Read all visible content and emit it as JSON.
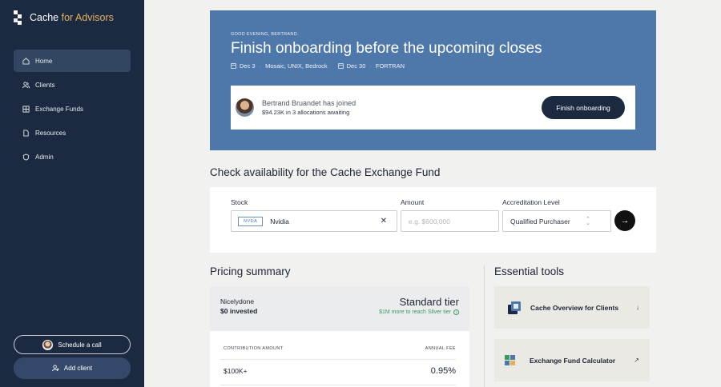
{
  "brand": {
    "name": "Cache",
    "suffix": " for Advisors"
  },
  "sidebar": {
    "items": [
      {
        "label": "Home",
        "icon": "home-icon",
        "active": true
      },
      {
        "label": "Clients",
        "icon": "users-icon"
      },
      {
        "label": "Exchange Funds",
        "icon": "grid-icon"
      },
      {
        "label": "Resources",
        "icon": "document-icon"
      },
      {
        "label": "Admin",
        "icon": "shield-icon"
      }
    ],
    "schedule_label": "Schedule a call",
    "add_client_label": "Add client"
  },
  "hero": {
    "greeting": "GOOD EVENING, BERTRAND.",
    "title": "Finish onboarding before the upcoming closes",
    "dates": [
      {
        "date": "Dec 3",
        "sep": "·",
        "detail": "Mosaic, UNIX, Bedrock"
      },
      {
        "date": "Dec 30",
        "sep": "·",
        "detail": "FORTRAN"
      }
    ],
    "card": {
      "name": "Bertrand Bruandet has joined",
      "sub": "$94.23K in 3 allocations awaiting",
      "button": "Finish onboarding"
    }
  },
  "availability": {
    "title": "Check availability for the Cache Exchange Fund",
    "stock_label": "Stock",
    "stock_ticker": "NVDA",
    "stock_value": "Nvidia",
    "clear_symbol": "✕",
    "amount_label": "Amount",
    "amount_placeholder": "e.g. $600,000",
    "accreditation_label": "Accreditation Level",
    "accreditation_value": "Qualified Purchaser",
    "go_symbol": "→"
  },
  "pricing": {
    "title": "Pricing summary",
    "client": "Nicelydone",
    "invested": "$0 invested",
    "tier": "Standard tier",
    "upgrade_note": "$1M more to reach Silver tier",
    "info_symbol": "i",
    "col_amount": "CONTRIBUTION AMOUNT",
    "col_fee": "ANNUAL FEE",
    "rows": [
      {
        "amount": "$100K+",
        "fee": "0.95%"
      }
    ]
  },
  "tools": {
    "title": "Essential tools",
    "items": [
      {
        "label": "Cache Overview for Clients",
        "action": "↓"
      },
      {
        "label": "Exchange Fund Calculator",
        "action": "↗"
      }
    ]
  },
  "colors": {
    "sidebar": "#1b2a41",
    "hero": "#4e77aa",
    "accent": "#e0b25c",
    "success": "#3a9a62"
  }
}
